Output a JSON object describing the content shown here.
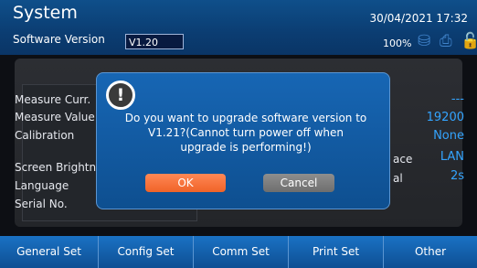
{
  "header": {
    "title": "System",
    "version_label": "Software Version",
    "version_value": "V1.20",
    "datetime": "30/04/2021 17:32",
    "battery": "100%",
    "icons": [
      "disk-icon",
      "printer-icon",
      "lock-icon"
    ]
  },
  "settings_left": [
    "Measure Curr.",
    "Measure Value",
    "Calibration",
    "Screen Brightness",
    "Language",
    "Serial No."
  ],
  "settings_right": {
    "values": [
      "---",
      "19200",
      "None",
      "LAN",
      "2s"
    ],
    "partial_labels": [
      "ace",
      "al"
    ]
  },
  "dialog": {
    "message": "Do you want to upgrade software version to V1.21?(Cannot turn power off when upgrade is performing!)",
    "ok_label": "OK",
    "cancel_label": "Cancel",
    "icon": "exclamation-icon"
  },
  "tabs": [
    "General Set",
    "Config Set",
    "Comm Set",
    "Print Set",
    "Other"
  ],
  "colors": {
    "header_bg": "#0b3d72",
    "accent_blue": "#33a4ff",
    "ok_orange": "#f06328",
    "cancel_gray": "#7a7a7a"
  }
}
